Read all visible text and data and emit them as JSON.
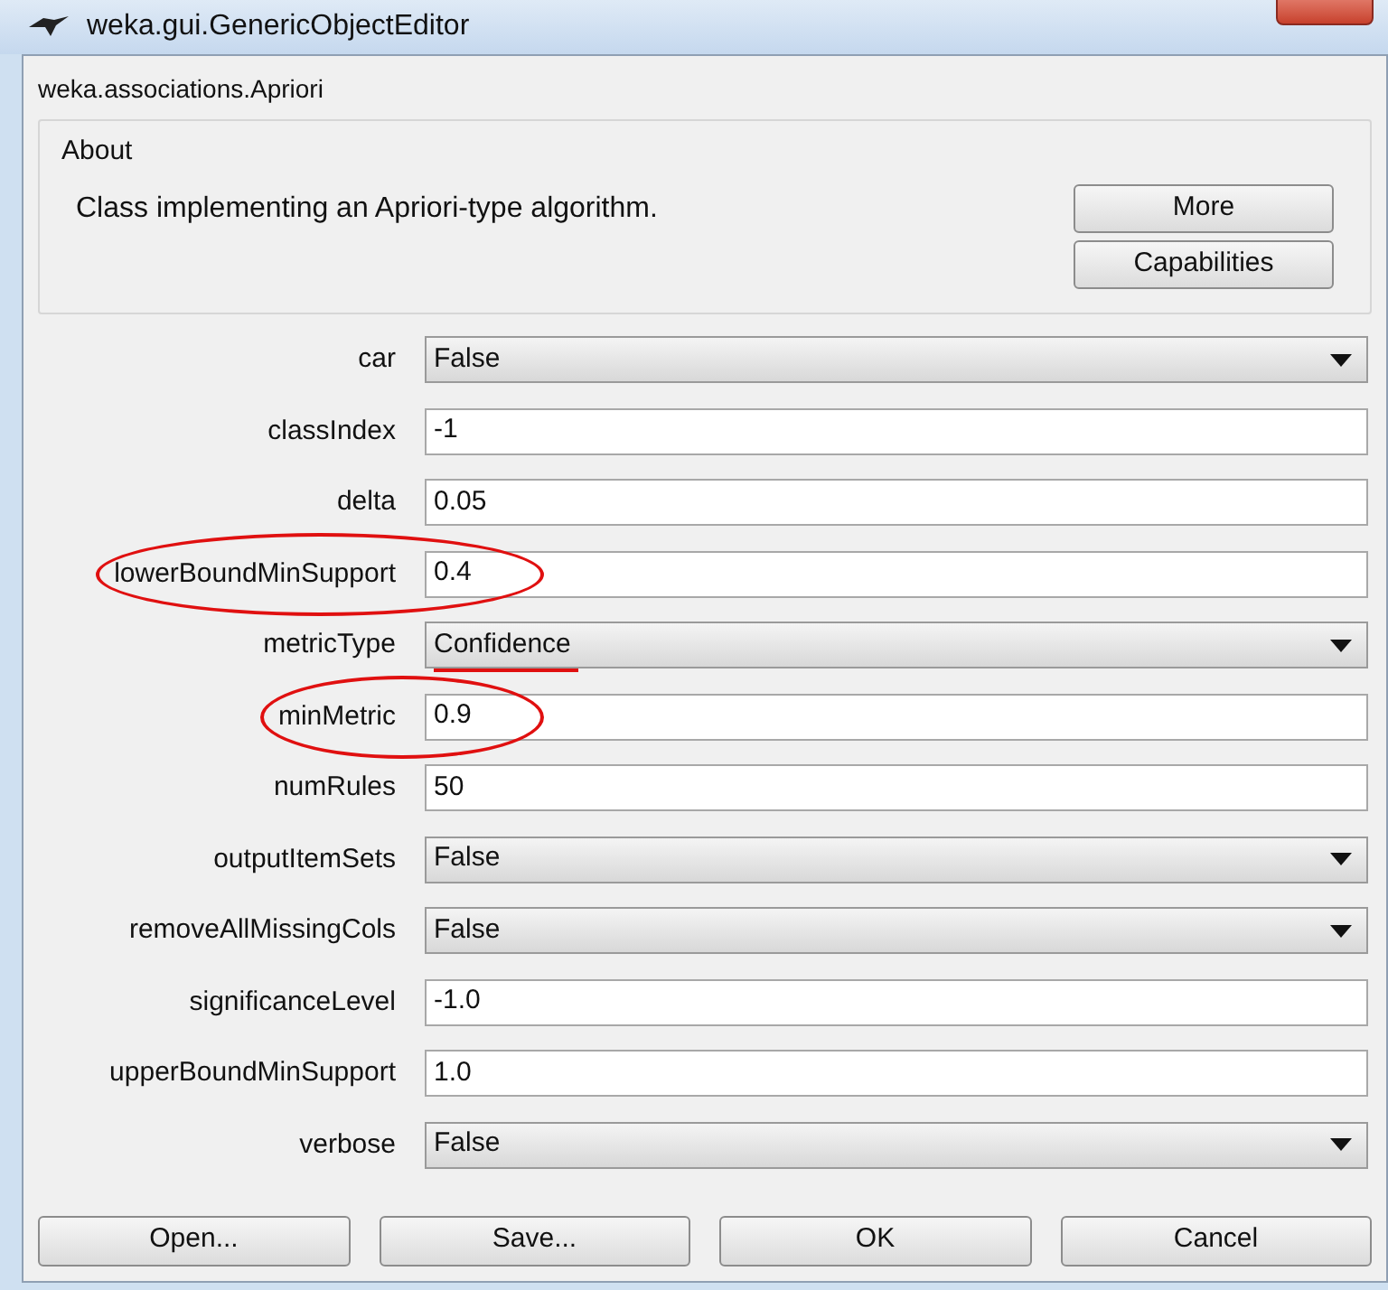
{
  "window": {
    "title": "weka.gui.GenericObjectEditor"
  },
  "class_name": "weka.associations.Apriori",
  "about": {
    "title": "About",
    "description": "Class implementing an Apriori-type algorithm.",
    "buttons": [
      "More",
      "Capabilities"
    ]
  },
  "properties": [
    {
      "name": "car",
      "kind": "dropdown",
      "value": "False",
      "circled": false,
      "underlined": false
    },
    {
      "name": "classIndex",
      "kind": "text",
      "value": "-1",
      "circled": false,
      "underlined": false
    },
    {
      "name": "delta",
      "kind": "text",
      "value": "0.05",
      "circled": false,
      "underlined": false
    },
    {
      "name": "lowerBoundMinSupport",
      "kind": "text",
      "value": "0.4",
      "circled": true,
      "underlined": false
    },
    {
      "name": "metricType",
      "kind": "dropdown",
      "value": "Confidence",
      "circled": false,
      "underlined": true
    },
    {
      "name": "minMetric",
      "kind": "text",
      "value": "0.9",
      "circled": true,
      "underlined": false
    },
    {
      "name": "numRules",
      "kind": "text",
      "value": "50",
      "circled": false,
      "underlined": false
    },
    {
      "name": "outputItemSets",
      "kind": "dropdown",
      "value": "False",
      "circled": false,
      "underlined": false
    },
    {
      "name": "removeAllMissingCols",
      "kind": "dropdown",
      "value": "False",
      "circled": false,
      "underlined": false
    },
    {
      "name": "significanceLevel",
      "kind": "text",
      "value": "-1.0",
      "circled": false,
      "underlined": false
    },
    {
      "name": "upperBoundMinSupport",
      "kind": "text",
      "value": "1.0",
      "circled": false,
      "underlined": false
    },
    {
      "name": "verbose",
      "kind": "dropdown",
      "value": "False",
      "circled": false,
      "underlined": false
    }
  ],
  "buttons": [
    "Open...",
    "Save...",
    "OK",
    "Cancel"
  ]
}
